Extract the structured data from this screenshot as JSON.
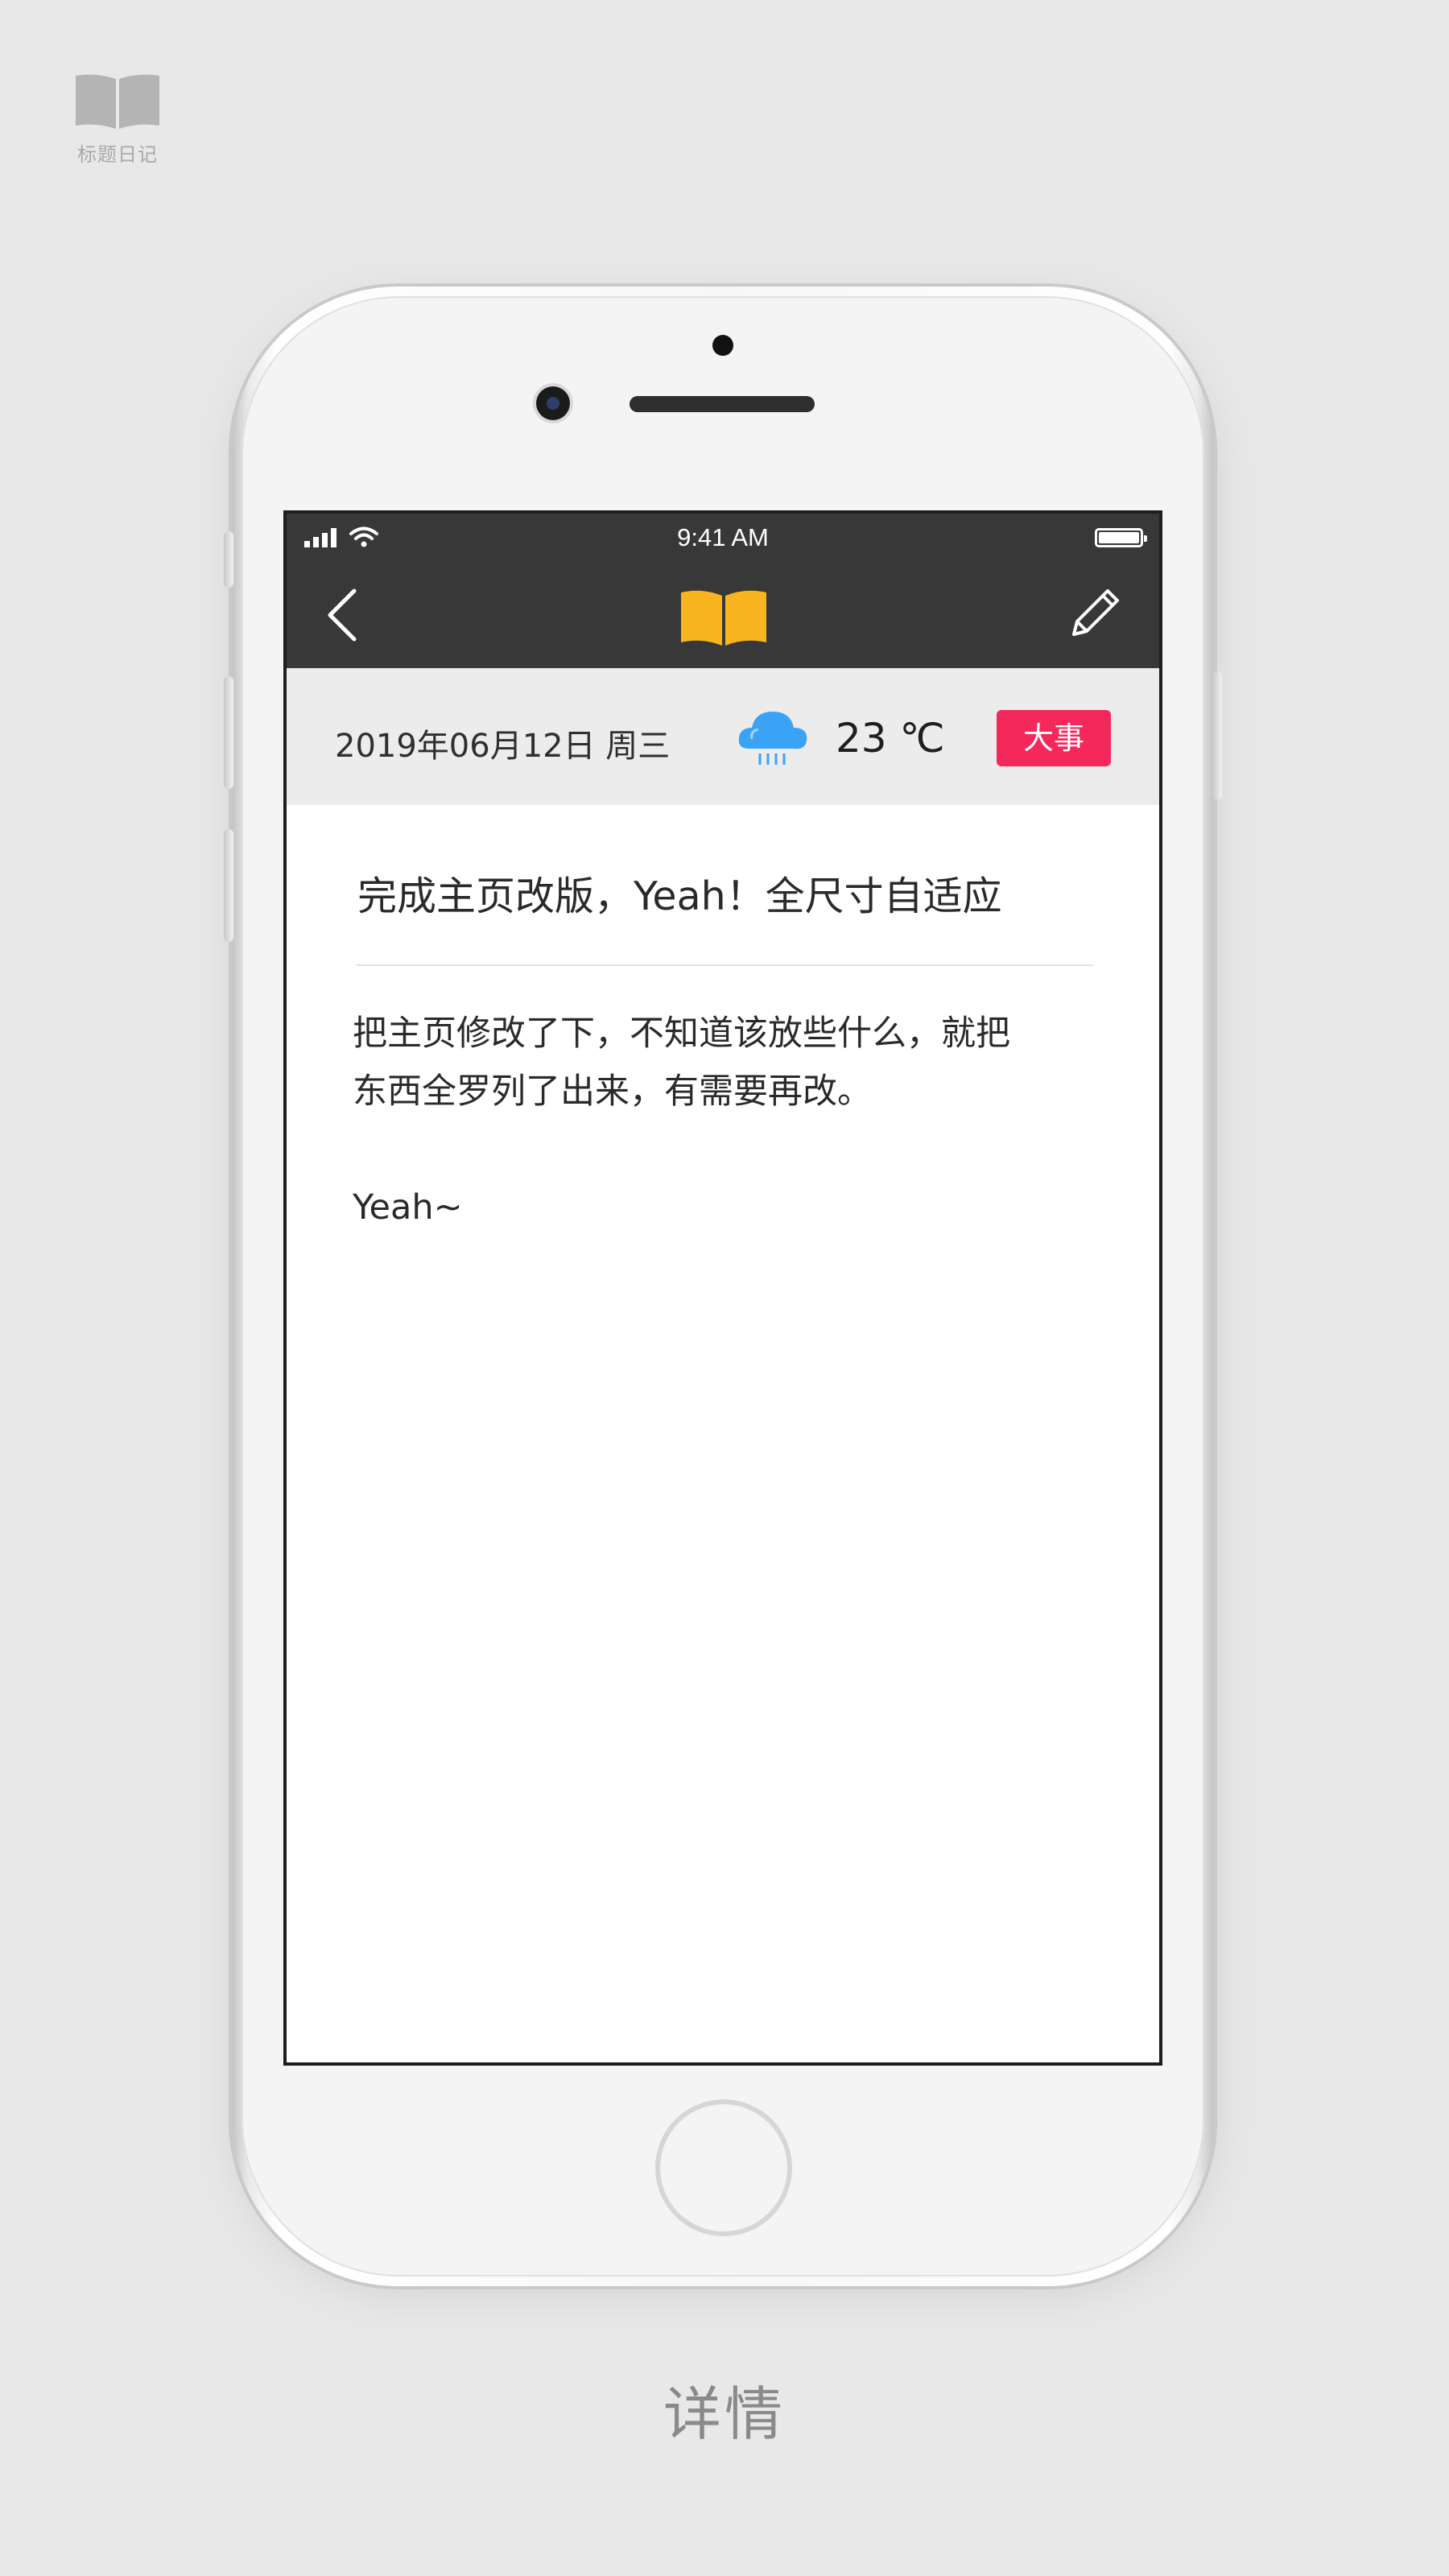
{
  "brand": {
    "label": "标题日记",
    "icon": "open-book-icon"
  },
  "status_bar": {
    "time": "9:41 AM",
    "icons": [
      "signal-icon",
      "wifi-icon",
      "battery-icon"
    ]
  },
  "nav": {
    "back_icon": "chevron-left-icon",
    "logo_icon": "open-book-icon",
    "edit_icon": "pencil-icon"
  },
  "meta": {
    "date": "2019年06月12日 周三",
    "weather_icon": "rain-cloud-icon",
    "temperature": "23 ℃",
    "tag": "大事"
  },
  "entry": {
    "title": "完成主页改版，Yeah！全尺寸自适应",
    "body_line1": "把主页修改了下，不知道该放些什么，就把",
    "body_line2": "东西全罗列了出来，有需要再改。",
    "body_line3": "Yeah~"
  },
  "caption": "详情",
  "colors": {
    "accent_yellow": "#f9b51f",
    "tag_red": "#f4285a",
    "nav_dark": "#383838",
    "weather_blue": "#3aa3f5"
  }
}
